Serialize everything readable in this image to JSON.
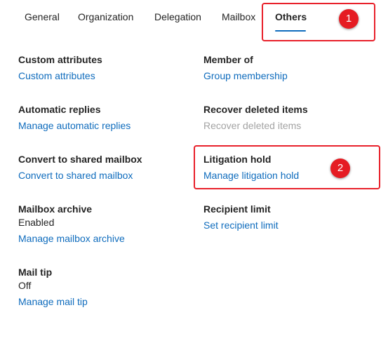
{
  "tabs": [
    {
      "label": "General",
      "active": false
    },
    {
      "label": "Organization",
      "active": false
    },
    {
      "label": "Delegation",
      "active": false
    },
    {
      "label": "Mailbox",
      "active": false
    },
    {
      "label": "Others",
      "active": true
    }
  ],
  "sections": {
    "custom_attributes": {
      "title": "Custom attributes",
      "link": "Custom attributes"
    },
    "member_of": {
      "title": "Member of",
      "link": "Group membership"
    },
    "automatic_replies": {
      "title": "Automatic replies",
      "link": "Manage automatic replies"
    },
    "recover_deleted_items": {
      "title": "Recover deleted items",
      "link": "Recover deleted items",
      "link_enabled": false
    },
    "convert_shared_mailbox": {
      "title": "Convert to shared mailbox",
      "link": "Convert to shared mailbox"
    },
    "litigation_hold": {
      "title": "Litigation hold",
      "link": "Manage litigation hold"
    },
    "mailbox_archive": {
      "title": "Mailbox archive",
      "value": "Enabled",
      "link": "Manage mailbox archive"
    },
    "recipient_limit": {
      "title": "Recipient limit",
      "link": "Set recipient limit"
    },
    "mail_tip": {
      "title": "Mail tip",
      "value": "Off",
      "link": "Manage mail tip"
    }
  },
  "annotations": {
    "badge_1": "1",
    "badge_2": "2"
  },
  "colors": {
    "link": "#0f6cbd",
    "disabled_link": "#a3a3a3",
    "annotation_red": "#e51c23",
    "active_tab_underline": "#0f6cbd"
  }
}
